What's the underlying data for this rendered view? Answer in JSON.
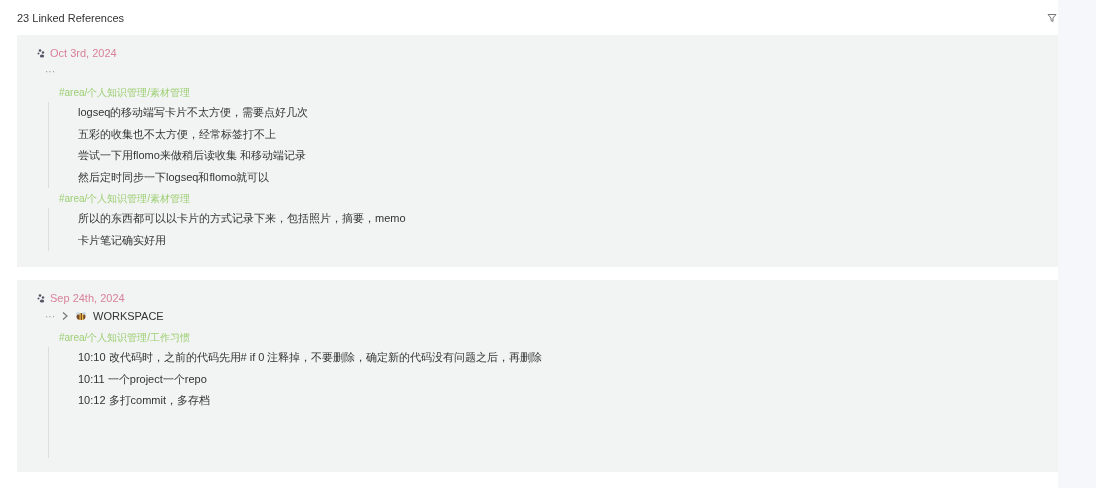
{
  "header": {
    "title": "23 Linked References"
  },
  "references": [
    {
      "date": "Oct 3rd, 2024",
      "breadcrumb": {
        "ellipsis": "···"
      },
      "groups": [
        {
          "tag": "#area/个人知识管理/素材管理",
          "lines": [
            "logseq的移动端写卡片不太方便，需要点好几次",
            "五彩的收集也不太方便，经常标签打不上",
            "尝试一下用flomo来做稍后读收集 和移动端记录",
            "然后定时同步一下logseq和flomo就可以"
          ]
        },
        {
          "tag": "#area/个人知识管理/素材管理",
          "lines": [
            "所以的东西都可以以卡片的方式记录下来，包括照片，摘要，memo",
            "卡片笔记确实好用"
          ]
        }
      ]
    },
    {
      "date": "Sep 24th, 2024",
      "breadcrumb": {
        "ellipsis": "···",
        "page": "WORKSPACE"
      },
      "groups": [
        {
          "tag": "#area/个人知识管理/工作习惯",
          "lines": [
            "10:10  改代码时，之前的代码先用# if 0 注释掉，不要删除，确定新的代码没有问题之后，再删除",
            "10:11 一个project一个repo",
            "10:12  多打commit，多存档"
          ]
        }
      ]
    }
  ]
}
